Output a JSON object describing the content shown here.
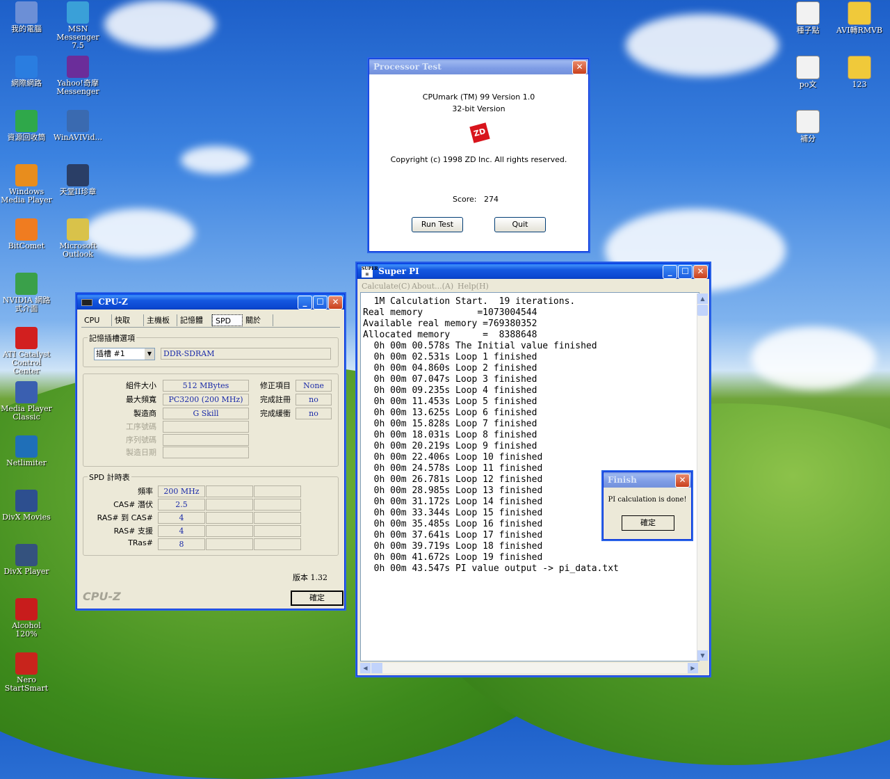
{
  "desktop_icons_left": [
    {
      "label": "我的電腦",
      "color": "#6c8fd6"
    },
    {
      "label": "網際網路",
      "color": "#2a7de0"
    },
    {
      "label": "資源回收筒",
      "color": "#2fa84a"
    },
    {
      "label": "Windows Media Player",
      "color": "#e88d1d"
    },
    {
      "label": "BitComet",
      "color": "#f07c20"
    },
    {
      "label": "NVIDIA 網路式介面",
      "color": "#3aa04a"
    },
    {
      "label": "ATI Catalyst Control Center",
      "color": "#d21f1f"
    },
    {
      "label": "Media Player Classic",
      "color": "#3a5fb0"
    },
    {
      "label": "Netlimiter",
      "color": "#1f6fb8"
    },
    {
      "label": "DivX Movies",
      "color": "#2d4f8f"
    },
    {
      "label": "DivX Player",
      "color": "#34527e"
    },
    {
      "label": "Alcohol 120%",
      "color": "#c81c1c"
    },
    {
      "label": "Nero StartSmart",
      "color": "#c8241c"
    }
  ],
  "desktop_icons_col2": [
    {
      "label": "MSN Messenger 7.5",
      "color": "#3aa0d8"
    },
    {
      "label": "Yahoo!奇摩 Messenger",
      "color": "#6b2d9a"
    },
    {
      "label": "WinAVIVid...",
      "color": "#3a6ab0"
    },
    {
      "label": "天堂II珍章",
      "color": "#2a3e66"
    },
    {
      "label": "Microsoft Outlook",
      "color": "#d9c24a"
    }
  ],
  "desktop_icons_right": [
    {
      "label": "種子點",
      "color": "#f2f2f2"
    },
    {
      "label": "AVI轉RMVB",
      "color": "#f0c93a"
    },
    {
      "label": "po文",
      "color": "#f2f2f2"
    },
    {
      "label": "123",
      "color": "#f0c93a"
    },
    {
      "label": "補分",
      "color": "#f2f2f2"
    }
  ],
  "processor_test": {
    "title": "Processor Test",
    "line1": "CPUmark (TM) 99 Version 1.0",
    "line2": "32-bit Version",
    "logo": "ZD",
    "copyright": "Copyright (c) 1998 ZD Inc. All rights reserved.",
    "score_label": "Score:",
    "score_value": "274",
    "run_button": "Run Test",
    "quit_button": "Quit"
  },
  "cpuz": {
    "title": "CPU-Z",
    "tabs": [
      "CPU",
      "快取",
      "主機板",
      "記憶體",
      "SPD",
      "關於"
    ],
    "active_tab": "SPD",
    "slot_group_title": "記憶插槽選項",
    "slot_value": "插槽 #1",
    "memory_type": "DDR-SDRAM",
    "labels": {
      "module_size": "組件大小",
      "max_bandwidth": "最大頻寬",
      "manufacturer": "製造商",
      "part_number": "工序號碼",
      "serial_number": "序列號碼",
      "manufacturing_date": "製造日期",
      "correction": "修正項目",
      "registered": "完成註冊",
      "buffered": "完成緩衝"
    },
    "values": {
      "module_size": "512 MBytes",
      "max_bandwidth": "PC3200 (200 MHz)",
      "manufacturer": "G Skill",
      "correction": "None",
      "registered": "no",
      "buffered": "no"
    },
    "timings_title": "SPD 計時表",
    "timings": [
      {
        "label": "頻率",
        "value": "200 MHz"
      },
      {
        "label": "CAS# 潛伏",
        "value": "2.5"
      },
      {
        "label": "RAS# 到 CAS#",
        "value": "4"
      },
      {
        "label": "RAS# 支援",
        "value": "4"
      },
      {
        "label": "TRas#",
        "value": "8"
      }
    ],
    "version": "版本 1.32",
    "brand": "CPU-Z",
    "ok_button": "確定"
  },
  "superpi": {
    "title": "Super PI",
    "icon_text": "SUPER π",
    "menu": [
      "Calculate(C)",
      "About...(A)",
      "Help(H)"
    ],
    "lines": [
      "  1M Calculation Start.  19 iterations.",
      "Real memory          =1073004544",
      "Available real memory =769380352",
      "Allocated memory      =  8388648",
      "  0h 00m 00.578s The Initial value finished",
      "  0h 00m 02.531s Loop 1 finished",
      "  0h 00m 04.860s Loop 2 finished",
      "  0h 00m 07.047s Loop 3 finished",
      "  0h 00m 09.235s Loop 4 finished",
      "  0h 00m 11.453s Loop 5 finished",
      "  0h 00m 13.625s Loop 6 finished",
      "  0h 00m 15.828s Loop 7 finished",
      "  0h 00m 18.031s Loop 8 finished",
      "  0h 00m 20.219s Loop 9 finished",
      "  0h 00m 22.406s Loop 10 finished",
      "  0h 00m 24.578s Loop 11 finished",
      "  0h 00m 26.781s Loop 12 finished",
      "  0h 00m 28.985s Loop 13 finished",
      "  0h 00m 31.172s Loop 14 finished",
      "  0h 00m 33.344s Loop 15 finished",
      "  0h 00m 35.485s Loop 16 finished",
      "  0h 00m 37.641s Loop 17 finished",
      "  0h 00m 39.719s Loop 18 finished",
      "  0h 00m 41.672s Loop 19 finished",
      "  0h 00m 43.547s PI value output -> pi_data.txt"
    ]
  },
  "finish_dialog": {
    "title": "Finish",
    "message": "PI calculation is done!",
    "ok_button": "確定"
  }
}
